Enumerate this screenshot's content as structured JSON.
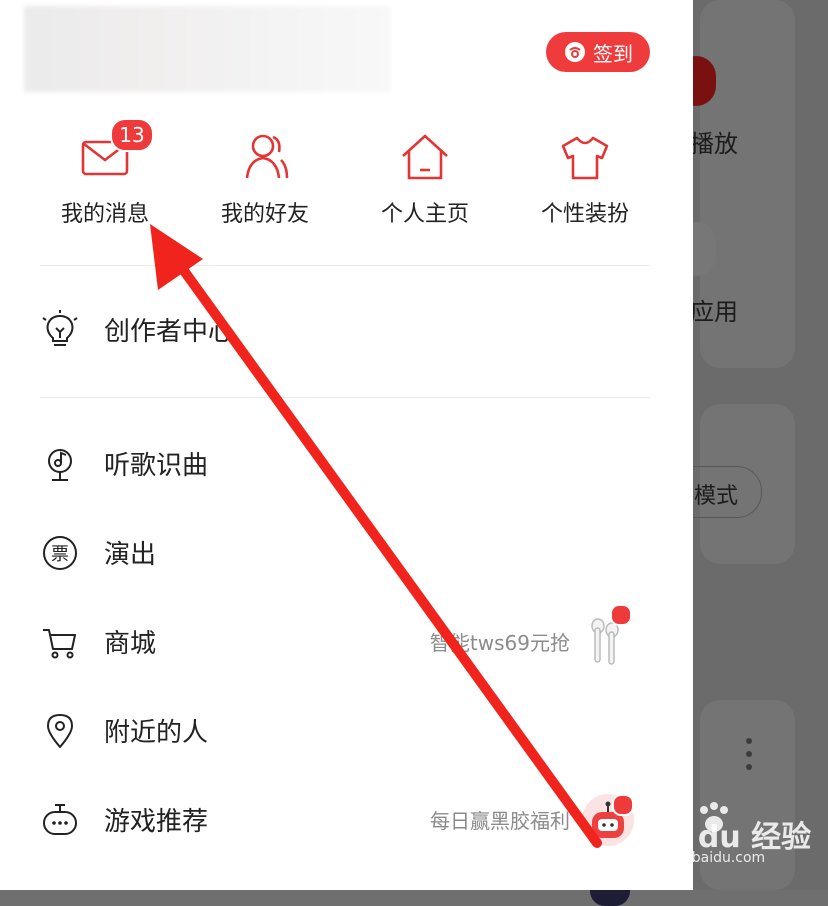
{
  "drawer": {
    "sign_in_label": "签到",
    "quick_actions": [
      {
        "label": "我的消息",
        "icon": "mail-icon",
        "badge": "13"
      },
      {
        "label": "我的好友",
        "icon": "friends-icon"
      },
      {
        "label": "个人主页",
        "icon": "home-icon"
      },
      {
        "label": "个性装扮",
        "icon": "shirt-icon"
      }
    ],
    "creator_center": {
      "label": "创作者中心",
      "icon": "lightbulb-icon"
    },
    "menu_items": [
      {
        "label": "听歌识曲",
        "icon": "music-recognition-icon"
      },
      {
        "label": "演出",
        "icon": "ticket-icon"
      },
      {
        "label": "商城",
        "icon": "cart-icon",
        "subtitle": "智能tws69元抢"
      },
      {
        "label": "附近的人",
        "icon": "location-pin-icon"
      },
      {
        "label": "游戏推荐",
        "icon": "gamepad-icon",
        "subtitle": "每日赢黑胶福利"
      }
    ]
  },
  "background": {
    "labels": [
      "播放",
      "应用",
      "模式"
    ]
  },
  "watermark": {
    "brand": "Bai du 经验",
    "url": "jingyan.baidu.com"
  },
  "colors": {
    "accent": "#ef3b3b",
    "annotation_arrow": "#f0241c"
  }
}
